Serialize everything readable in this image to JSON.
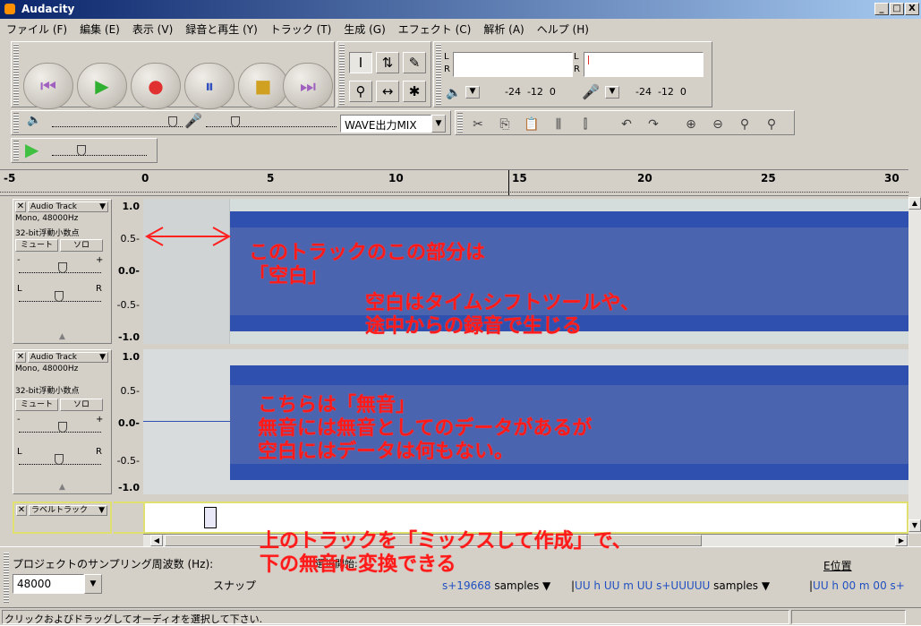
{
  "window": {
    "title": "Audacity",
    "min": "_",
    "max": "□",
    "close": "X"
  },
  "menu": [
    "ファイル (F)",
    "編集 (E)",
    "表示 (V)",
    "録音と再生 (Y)",
    "トラック (T)",
    "生成 (G)",
    "エフェクト (C)",
    "解析 (A)",
    "ヘルプ (H)"
  ],
  "transport": {
    "rewind": "⏮",
    "play": "▶",
    "record": "●",
    "pause": "⏸",
    "stop": "■",
    "fastforward": "⏭"
  },
  "tools": {
    "select": "I",
    "envelope": "⇅",
    "draw": "✎",
    "zoom": "⚲",
    "timeshift": "↔",
    "multi": "✱"
  },
  "meters": {
    "out_l": "L",
    "out_r": "R",
    "in_l": "L",
    "in_r": "R",
    "scale_out": "-24  -12  0",
    "scale_in": "-24  -12  0"
  },
  "mixer": {
    "source": "WAVE出力MIX"
  },
  "ruler": {
    "ticks": [
      "-5",
      "0",
      "5",
      "10",
      "15",
      "20",
      "25",
      "30"
    ]
  },
  "tracks": [
    {
      "name": "Audio Track",
      "info1": "Mono, 48000Hz",
      "info2": "32-bit浮動小数点",
      "mute": "ミュート",
      "solo": "ソロ",
      "plus": "+",
      "minus": "-",
      "l": "L",
      "r": "R",
      "scale": [
        "1.0",
        "0.5-",
        "0.0-",
        "-0.5-",
        "-1.0"
      ]
    },
    {
      "name": "Audio Track",
      "info1": "Mono, 48000Hz",
      "info2": "32-bit浮動小数点",
      "mute": "ミュート",
      "solo": "ソロ",
      "plus": "+",
      "minus": "-",
      "l": "L",
      "r": "R",
      "scale": [
        "1.0",
        "0.5-",
        "0.0-",
        "-0.5-",
        "-1.0"
      ]
    }
  ],
  "label_track": {
    "name": "ラベルトラック"
  },
  "annotations": {
    "a1": "このトラックのこの部分は\n「空白」",
    "a2": "空白はタイムシフトツールや、\n途中からの録音で生じる",
    "a3": "こちらは「無音」\n無音には無音としてのデータがあるが\n空白にはデータは何もない。",
    "a4": "上のトラックを「ミックスして作成」で、\n下の無音に変換できる"
  },
  "bottom": {
    "rate_label": "プロジェクトのサンプリング周波数 (Hz):",
    "rate_value": "48000",
    "snap_label": "スナップ",
    "sel_start_label": "選択開始:",
    "sel_start_value": "s+19668",
    "samples1": "samples",
    "sel_end_value": "UU h UU m UU s+UUUUU",
    "samples2": "samples",
    "pos_label": "E位置",
    "pos_value": "UU h 00 m 00 s+"
  },
  "status": "クリックおよびドラッグしてオーディオを選択して下さい."
}
